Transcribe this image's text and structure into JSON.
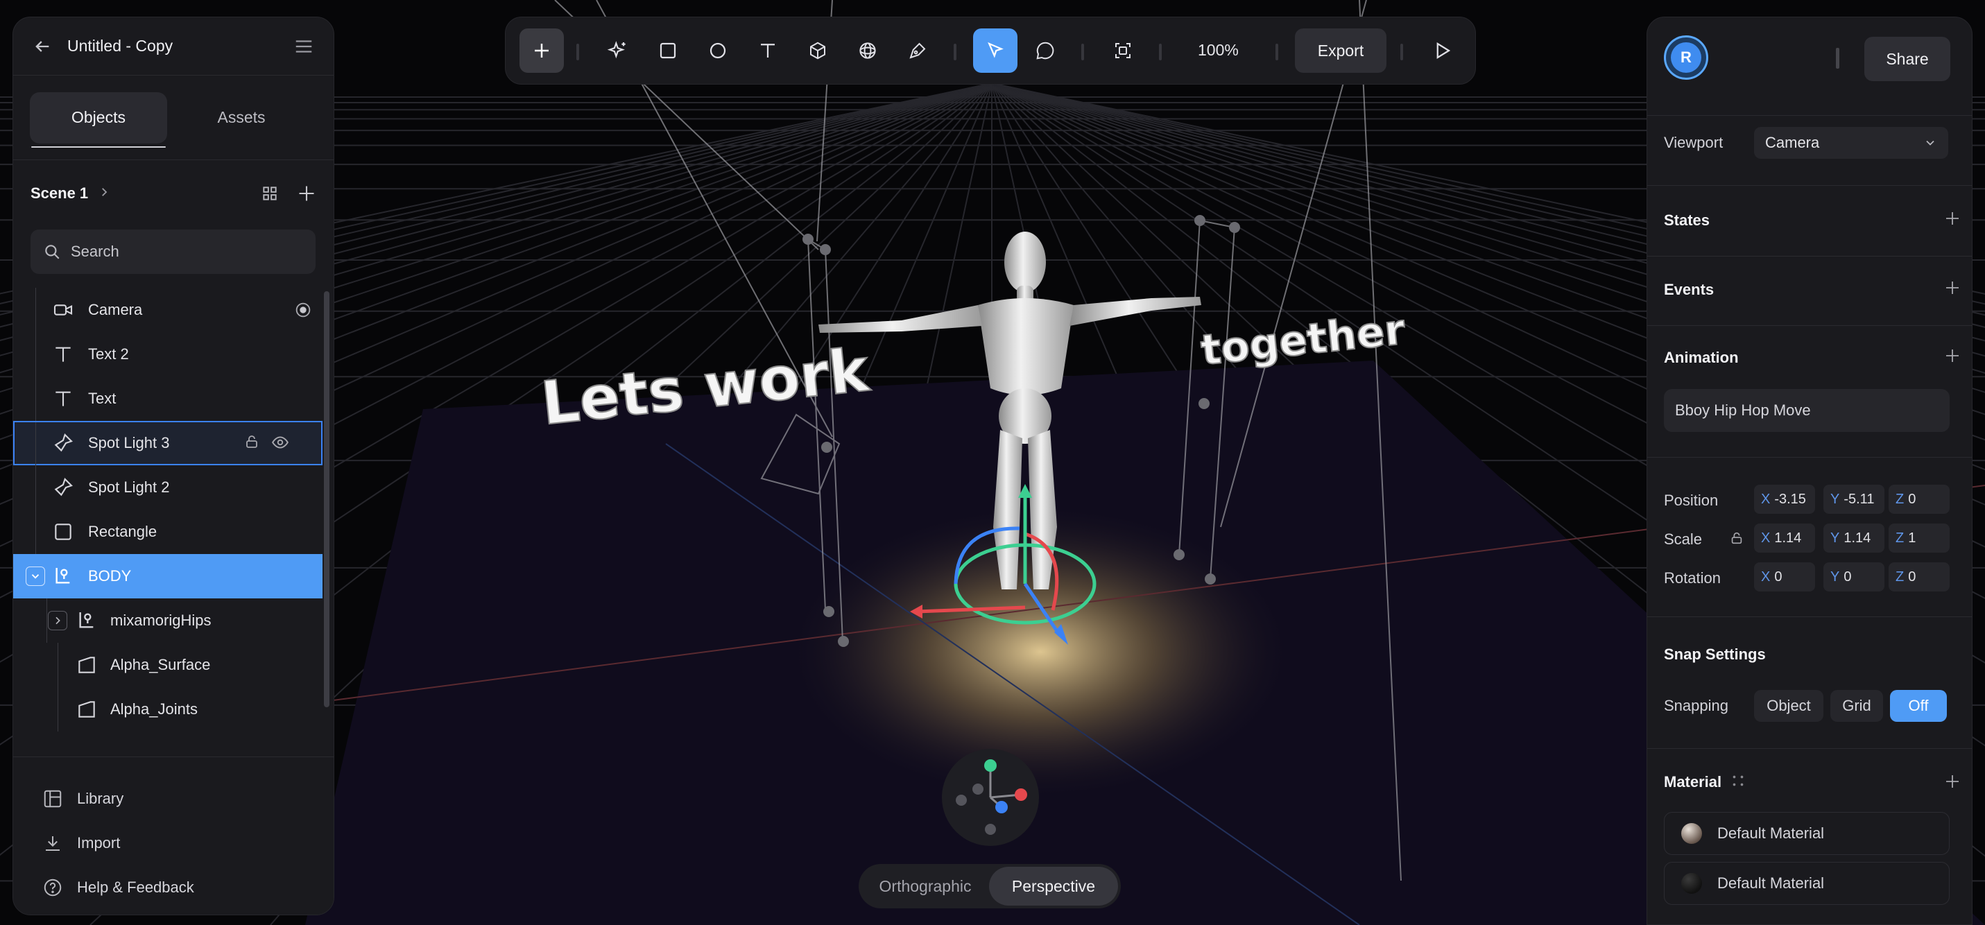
{
  "window": {
    "title": "Untitled - Copy"
  },
  "left_panel": {
    "tabs": [
      {
        "label": "Objects",
        "active": true
      },
      {
        "label": "Assets",
        "active": false
      }
    ],
    "scene": {
      "label": "Scene 1"
    },
    "search": {
      "placeholder": "Search"
    },
    "tree": [
      {
        "label": "Camera",
        "icon": "camera-icon"
      },
      {
        "label": "Text 2",
        "icon": "text-icon"
      },
      {
        "label": "Text",
        "icon": "text-icon"
      },
      {
        "label": "Spot Light 3",
        "icon": "spotlight-icon",
        "state": "hover"
      },
      {
        "label": "Spot Light 2",
        "icon": "spotlight-icon"
      },
      {
        "label": "Rectangle",
        "icon": "rectangle-icon"
      },
      {
        "label": "BODY",
        "icon": "bone-group-icon",
        "state": "selected",
        "expanded": true
      },
      {
        "label": "mixamorigHips",
        "icon": "bone-group-icon",
        "indent": 1,
        "expanded": false
      },
      {
        "label": "Alpha_Surface",
        "icon": "mesh-icon",
        "indent": 1
      },
      {
        "label": "Alpha_Joints",
        "icon": "mesh-icon",
        "indent": 1
      }
    ],
    "footer": [
      {
        "label": "Library",
        "icon": "library-icon"
      },
      {
        "label": "Import",
        "icon": "import-icon"
      },
      {
        "label": "Help & Feedback",
        "icon": "help-icon"
      }
    ]
  },
  "toolbar": {
    "tools": [
      "add-icon",
      "sparkle-icon",
      "rectangle-tool-icon",
      "ellipse-tool-icon",
      "text-tool-icon",
      "cube-tool-icon",
      "sphere-tool-icon",
      "pen-tool-icon",
      "select-tool-icon",
      "comment-tool-icon",
      "frame-icon"
    ],
    "active_tool": "select-tool-icon",
    "zoom": "100%",
    "export_label": "Export"
  },
  "viewport": {
    "text_3d_left": "Lets work",
    "text_3d_right": "together",
    "view_modes": [
      {
        "label": "Orthographic",
        "active": false
      },
      {
        "label": "Perspective",
        "active": true
      }
    ],
    "colors": {
      "x_axis": "#e5484d",
      "y_axis": "#3ccf91",
      "z_axis": "#3b82f6",
      "accent": "#4f9bf5"
    }
  },
  "right_panel": {
    "avatar_initial": "R",
    "share_label": "Share",
    "viewport": {
      "label": "Viewport",
      "value": "Camera"
    },
    "sections": {
      "states": "States",
      "events": "Events",
      "animation": "Animation",
      "snap": "Snap Settings",
      "material": "Material"
    },
    "animation_value": "Bboy Hip Hop Move",
    "transform": {
      "position": {
        "label": "Position",
        "x": "-3.15",
        "y": "-5.11",
        "z": "0"
      },
      "scale": {
        "label": "Scale",
        "x": "1.14",
        "y": "1.14",
        "z": "1"
      },
      "rotation": {
        "label": "Rotation",
        "x": "0",
        "y": "0",
        "z": "0"
      }
    },
    "snapping": {
      "label": "Snapping",
      "options": [
        "Object",
        "Grid",
        "Off"
      ],
      "selected": "Off"
    },
    "materials": [
      "Default Material",
      "Default Material"
    ]
  }
}
